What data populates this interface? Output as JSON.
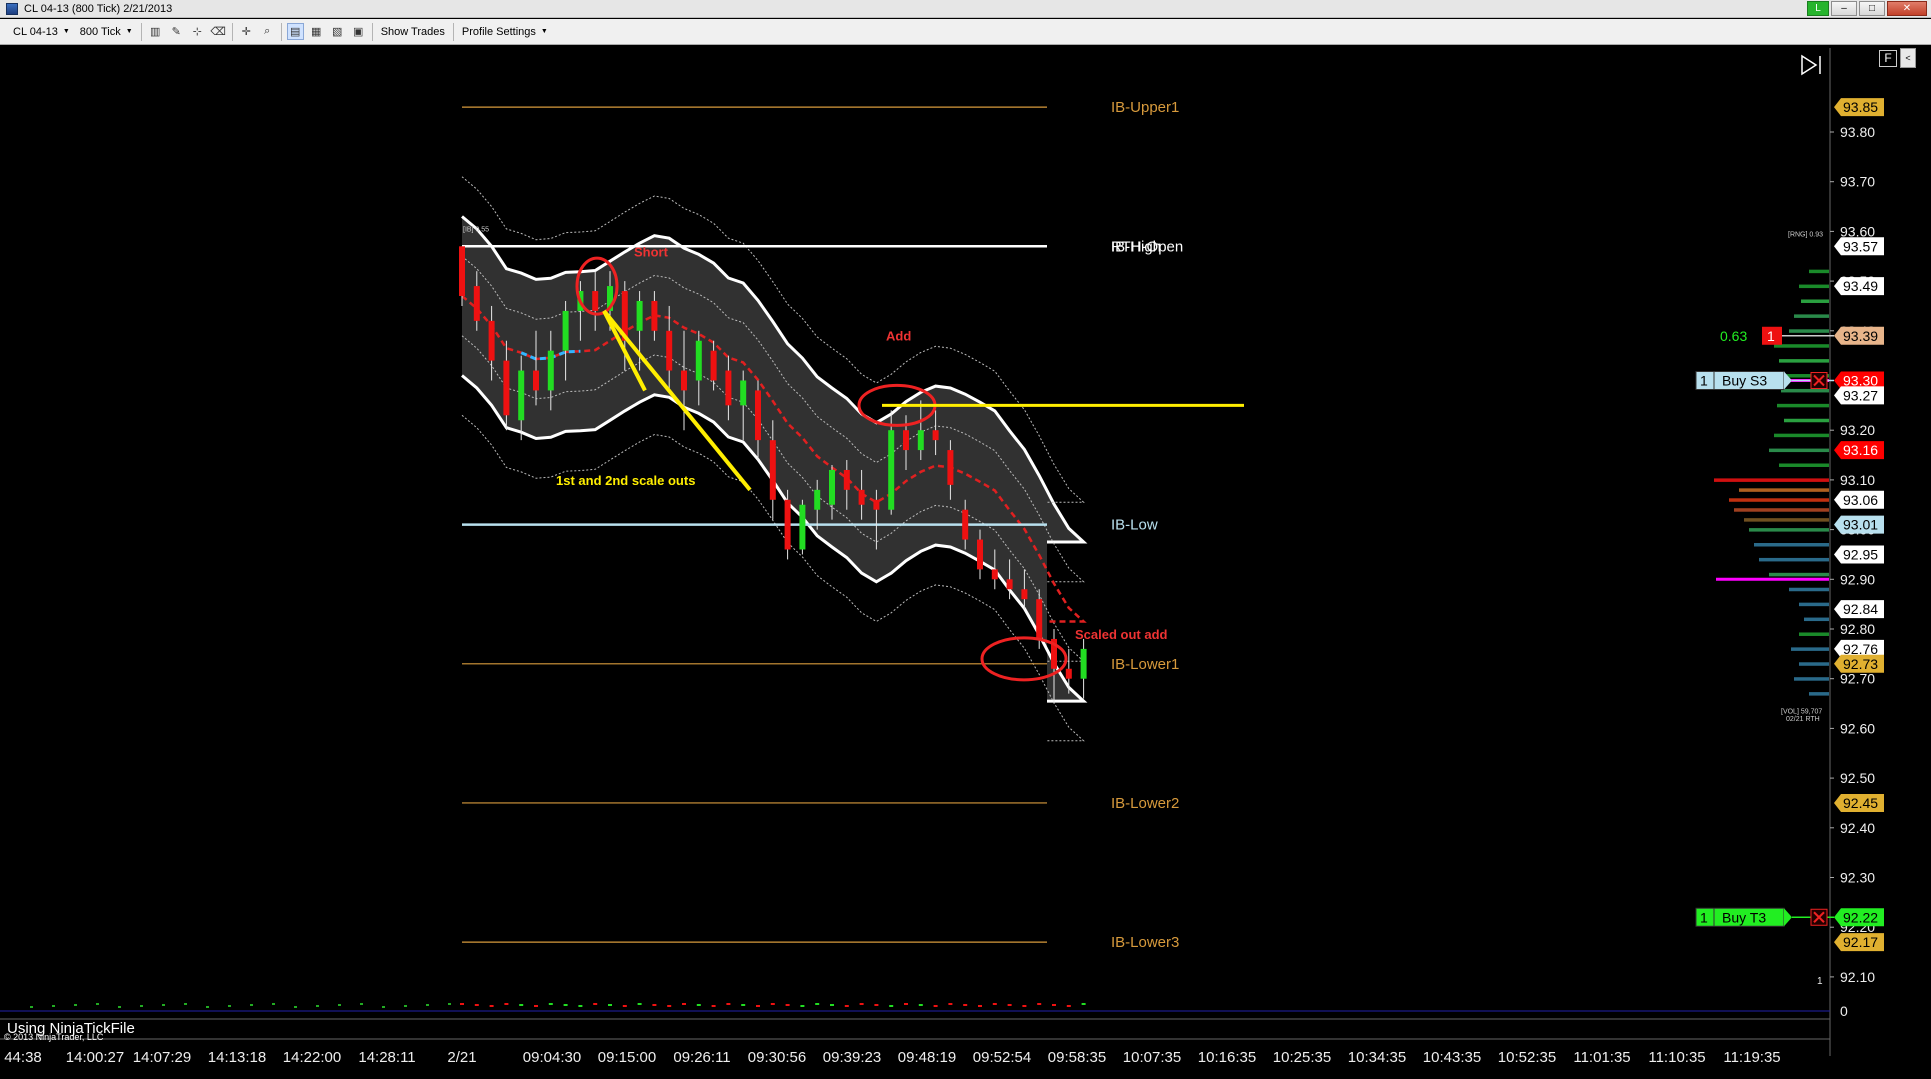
{
  "window": {
    "title": "CL 04-13 (800 Tick)  2/21/2013",
    "status_indicator": "L",
    "minimize": "–",
    "maximize": "□",
    "close": "✕"
  },
  "toolbar": {
    "instrument": "CL 04-13",
    "interval": "800 Tick",
    "show_trades": "Show Trades",
    "profile_settings": "Profile Settings"
  },
  "chart_buttons": {
    "f_button": "F",
    "expand": "<"
  },
  "price_axis": {
    "labels": [
      "93.80",
      "93.70",
      "93.60",
      "93.50",
      "93.40",
      "93.30",
      "93.20",
      "93.10",
      "93.00",
      "92.90",
      "92.80",
      "92.70",
      "92.60",
      "92.50",
      "92.40",
      "92.30",
      "92.20",
      "92.10"
    ],
    "min": 92.0,
    "max": 93.9
  },
  "price_markers": [
    {
      "value": "93.85",
      "bg": "#e0b030",
      "fg": "#000"
    },
    {
      "value": "93.57",
      "bg": "#ffffff",
      "fg": "#000"
    },
    {
      "value": "93.49",
      "bg": "#ffffff",
      "fg": "#000"
    },
    {
      "value": "93.39",
      "bg": "#e7b48a",
      "fg": "#000"
    },
    {
      "value": "93.30",
      "bg": "#ff0000",
      "fg": "#fff"
    },
    {
      "value": "93.27",
      "bg": "#ffffff",
      "fg": "#000"
    },
    {
      "value": "93.16",
      "bg": "#ff0000",
      "fg": "#fff"
    },
    {
      "value": "93.06",
      "bg": "#ffffff",
      "fg": "#000"
    },
    {
      "value": "93.01",
      "bg": "#b8e0ee",
      "fg": "#000"
    },
    {
      "value": "92.95",
      "bg": "#ffffff",
      "fg": "#000"
    },
    {
      "value": "92.84",
      "bg": "#ffffff",
      "fg": "#000"
    },
    {
      "value": "92.76",
      "bg": "#ffffff",
      "fg": "#000"
    },
    {
      "value": "92.73",
      "bg": "#e0b030",
      "fg": "#000"
    },
    {
      "value": "92.45",
      "bg": "#e0b030",
      "fg": "#000"
    },
    {
      "value": "92.22",
      "bg": "#22ee22",
      "fg": "#000"
    },
    {
      "value": "92.17",
      "bg": "#e0b030",
      "fg": "#000"
    }
  ],
  "time_axis": [
    "44:38",
    "14:00:27",
    "14:07:29",
    "14:13:18",
    "14:22:00",
    "14:28:11",
    "2/21",
    "09:04:30",
    "09:15:00",
    "09:26:11",
    "09:30:56",
    "09:39:23",
    "09:48:19",
    "09:52:54",
    "09:58:35",
    "10:07:35",
    "10:16:35",
    "10:25:35",
    "10:34:35",
    "10:43:35",
    "10:52:35",
    "11:01:35",
    "11:10:35",
    "11:19:35"
  ],
  "levels": [
    {
      "label": "IB-Upper1",
      "price": 93.85,
      "color": "#d79a3c"
    },
    {
      "label": "IB-High",
      "price": 93.57,
      "color": "#ffffff"
    },
    {
      "label": "RTH-Open",
      "price": 93.57,
      "color": "#ffffff"
    },
    {
      "label": "IB-Low",
      "price": 93.01,
      "color": "#b8e0ee"
    },
    {
      "label": "IB-Lower1",
      "price": 92.73,
      "color": "#d79a3c"
    },
    {
      "label": "IB-Lower2",
      "price": 92.45,
      "color": "#d79a3c"
    },
    {
      "label": "IB-Lower3",
      "price": 92.17,
      "color": "#d79a3c"
    }
  ],
  "annotations": {
    "short": "Short",
    "add": "Add",
    "scale_outs": "1st and 2nd scale outs",
    "scaled_out_add": "Scaled out add",
    "ib_small": "[IB] 0.55",
    "rng_small": "[RNG] 0.93",
    "vol_small": "[VOL] 59,707",
    "vol_date": "02/21 RTH"
  },
  "orders": [
    {
      "qty": "1",
      "label": "Buy S3",
      "price": 93.3,
      "bg": "#b8e0ee"
    },
    {
      "qty": "1",
      "label": "Buy T3",
      "price": 92.22,
      "bg": "#22ee22"
    }
  ],
  "position": {
    "pnl": "0.63",
    "qty": "1",
    "price": 93.39
  },
  "volume_panel": {
    "zero": "0",
    "one": "1",
    "tick_file": "Using NinjaTickFile",
    "copyright": "© 2013 NinjaTrader, LLC"
  },
  "chart_data": {
    "type": "candlestick",
    "ylim": [
      92.0,
      93.9
    ],
    "candles": [
      {
        "o": 93.57,
        "h": 93.57,
        "l": 93.45,
        "c": 93.47
      },
      {
        "o": 93.49,
        "h": 93.52,
        "l": 93.4,
        "c": 93.42
      },
      {
        "o": 93.42,
        "h": 93.45,
        "l": 93.3,
        "c": 93.34
      },
      {
        "o": 93.34,
        "h": 93.38,
        "l": 93.2,
        "c": 93.23
      },
      {
        "o": 93.22,
        "h": 93.35,
        "l": 93.18,
        "c": 93.32
      },
      {
        "o": 93.32,
        "h": 93.4,
        "l": 93.25,
        "c": 93.28
      },
      {
        "o": 93.28,
        "h": 93.4,
        "l": 93.24,
        "c": 93.36
      },
      {
        "o": 93.36,
        "h": 93.46,
        "l": 93.3,
        "c": 93.44
      },
      {
        "o": 93.44,
        "h": 93.5,
        "l": 93.38,
        "c": 93.48
      },
      {
        "o": 93.48,
        "h": 93.52,
        "l": 93.4,
        "c": 93.44
      },
      {
        "o": 93.44,
        "h": 93.52,
        "l": 93.4,
        "c": 93.49
      },
      {
        "o": 93.48,
        "h": 93.5,
        "l": 93.32,
        "c": 93.38
      },
      {
        "o": 93.4,
        "h": 93.48,
        "l": 93.32,
        "c": 93.46
      },
      {
        "o": 93.46,
        "h": 93.48,
        "l": 93.38,
        "c": 93.4
      },
      {
        "o": 93.4,
        "h": 93.45,
        "l": 93.28,
        "c": 93.32
      },
      {
        "o": 93.32,
        "h": 93.4,
        "l": 93.2,
        "c": 93.28
      },
      {
        "o": 93.3,
        "h": 93.4,
        "l": 93.25,
        "c": 93.38
      },
      {
        "o": 93.36,
        "h": 93.38,
        "l": 93.28,
        "c": 93.3
      },
      {
        "o": 93.32,
        "h": 93.35,
        "l": 93.22,
        "c": 93.25
      },
      {
        "o": 93.25,
        "h": 93.32,
        "l": 93.18,
        "c": 93.3
      },
      {
        "o": 93.28,
        "h": 93.3,
        "l": 93.14,
        "c": 93.18
      },
      {
        "o": 93.18,
        "h": 93.22,
        "l": 93.02,
        "c": 93.06
      },
      {
        "o": 93.06,
        "h": 93.08,
        "l": 92.94,
        "c": 92.96
      },
      {
        "o": 92.96,
        "h": 93.06,
        "l": 92.95,
        "c": 93.05
      },
      {
        "o": 93.04,
        "h": 93.1,
        "l": 93.0,
        "c": 93.08
      },
      {
        "o": 93.05,
        "h": 93.13,
        "l": 93.02,
        "c": 93.12
      },
      {
        "o": 93.12,
        "h": 93.14,
        "l": 93.04,
        "c": 93.08
      },
      {
        "o": 93.08,
        "h": 93.12,
        "l": 93.02,
        "c": 93.05
      },
      {
        "o": 93.06,
        "h": 93.08,
        "l": 92.96,
        "c": 93.04
      },
      {
        "o": 93.04,
        "h": 93.24,
        "l": 93.03,
        "c": 93.2
      },
      {
        "o": 93.2,
        "h": 93.23,
        "l": 93.12,
        "c": 93.16
      },
      {
        "o": 93.16,
        "h": 93.26,
        "l": 93.14,
        "c": 93.2
      },
      {
        "o": 93.2,
        "h": 93.24,
        "l": 93.15,
        "c": 93.18
      },
      {
        "o": 93.16,
        "h": 93.18,
        "l": 93.06,
        "c": 93.09
      },
      {
        "o": 93.04,
        "h": 93.06,
        "l": 92.96,
        "c": 92.98
      },
      {
        "o": 92.98,
        "h": 93.0,
        "l": 92.9,
        "c": 92.92
      },
      {
        "o": 92.92,
        "h": 92.96,
        "l": 92.88,
        "c": 92.9
      },
      {
        "o": 92.9,
        "h": 92.94,
        "l": 92.86,
        "c": 92.88
      },
      {
        "o": 92.88,
        "h": 92.92,
        "l": 92.84,
        "c": 92.86
      },
      {
        "o": 92.86,
        "h": 92.88,
        "l": 92.76,
        "c": 92.78
      },
      {
        "o": 92.78,
        "h": 92.8,
        "l": 92.65,
        "c": 92.72
      },
      {
        "o": 92.72,
        "h": 92.76,
        "l": 92.67,
        "c": 92.7
      },
      {
        "o": 92.7,
        "h": 92.78,
        "l": 92.66,
        "c": 92.76
      }
    ],
    "volume_profile": [
      {
        "p": 93.52,
        "v": 20,
        "c": "#1a8a2a"
      },
      {
        "p": 93.49,
        "v": 30,
        "c": "#1a8a2a"
      },
      {
        "p": 93.46,
        "v": 28,
        "c": "#2aa040"
      },
      {
        "p": 93.43,
        "v": 35,
        "c": "#2a8a4a"
      },
      {
        "p": 93.4,
        "v": 40,
        "c": "#2a8a4a"
      },
      {
        "p": 93.37,
        "v": 55,
        "c": "#1a8a2a"
      },
      {
        "p": 93.34,
        "v": 50,
        "c": "#2aa040"
      },
      {
        "p": 93.31,
        "v": 60,
        "c": "#1a8a2a"
      },
      {
        "p": 93.28,
        "v": 48,
        "c": "#2a8a4a"
      },
      {
        "p": 93.25,
        "v": 52,
        "c": "#1a8a2a"
      },
      {
        "p": 93.22,
        "v": 45,
        "c": "#2aa040"
      },
      {
        "p": 93.19,
        "v": 55,
        "c": "#1a8a2a"
      },
      {
        "p": 93.16,
        "v": 60,
        "c": "#2a8a4a"
      },
      {
        "p": 93.13,
        "v": 50,
        "c": "#1a8a2a"
      },
      {
        "p": 93.1,
        "v": 115,
        "c": "#d01010"
      },
      {
        "p": 93.08,
        "v": 90,
        "c": "#b06020"
      },
      {
        "p": 93.06,
        "v": 100,
        "c": "#c03010"
      },
      {
        "p": 93.04,
        "v": 95,
        "c": "#a04020"
      },
      {
        "p": 93.02,
        "v": 85,
        "c": "#705020"
      },
      {
        "p": 93.0,
        "v": 80,
        "c": "#2a8a4a"
      },
      {
        "p": 92.97,
        "v": 75,
        "c": "#2a6a8a"
      },
      {
        "p": 92.94,
        "v": 70,
        "c": "#2a6a8a"
      },
      {
        "p": 92.91,
        "v": 60,
        "c": "#2a8a4a"
      },
      {
        "p": 92.88,
        "v": 40,
        "c": "#2a6a8a"
      },
      {
        "p": 92.85,
        "v": 30,
        "c": "#2a6a8a"
      },
      {
        "p": 92.82,
        "v": 25,
        "c": "#2a6a8a"
      },
      {
        "p": 92.79,
        "v": 30,
        "c": "#1a8a2a"
      },
      {
        "p": 92.76,
        "v": 38,
        "c": "#2a6a8a"
      },
      {
        "p": 92.73,
        "v": 30,
        "c": "#2a6a8a"
      },
      {
        "p": 92.7,
        "v": 35,
        "c": "#2a6a8a"
      },
      {
        "p": 92.67,
        "v": 20,
        "c": "#2a6a8a"
      }
    ]
  }
}
